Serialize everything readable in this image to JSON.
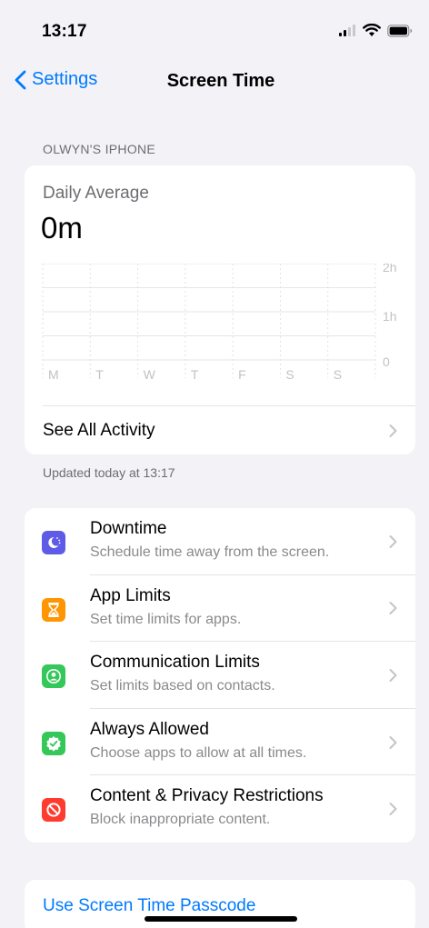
{
  "status_bar": {
    "time": "13:17",
    "icons": [
      "cellular-signal-icon",
      "wifi-icon",
      "battery-icon"
    ]
  },
  "nav": {
    "back_label": "Settings",
    "title": "Screen Time"
  },
  "device_section": {
    "header": "OLWYN'S IPHONE"
  },
  "usage": {
    "label": "Daily Average",
    "value": "0m",
    "chart_y_labels": [
      "2h",
      "1h",
      "0"
    ],
    "chart_days": [
      "M",
      "T",
      "W",
      "T",
      "F",
      "S",
      "S"
    ],
    "see_all_label": "See All Activity"
  },
  "updated_text": "Updated today at 13:17",
  "options": [
    {
      "title": "Downtime",
      "subtitle": "Schedule time away from the screen.",
      "icon": "downtime-icon",
      "color": "#5e5ce6"
    },
    {
      "title": "App Limits",
      "subtitle": "Set time limits for apps.",
      "icon": "hourglass-icon",
      "color": "#ff9500"
    },
    {
      "title": "Communication Limits",
      "subtitle": "Set limits based on contacts.",
      "icon": "contact-icon",
      "color": "#34c759"
    },
    {
      "title": "Always Allowed",
      "subtitle": "Choose apps to allow at all times.",
      "icon": "checkmark-seal-icon",
      "color": "#34c759"
    },
    {
      "title": "Content & Privacy Restrictions",
      "subtitle": "Block inappropriate content.",
      "icon": "restriction-icon",
      "color": "#ff3b30"
    }
  ],
  "passcode": {
    "label": "Use Screen Time Passcode"
  },
  "colors": {
    "accent": "#007aff",
    "background": "#f2f2f7"
  }
}
